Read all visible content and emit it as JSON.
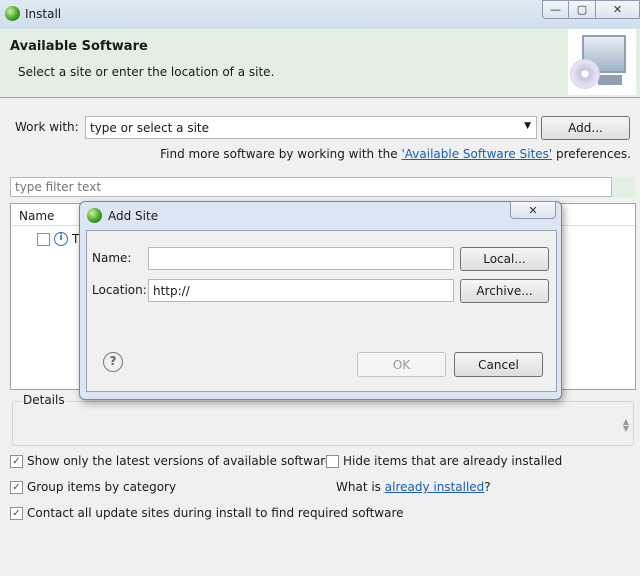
{
  "window": {
    "title": "Install",
    "minimize": "—",
    "maximize": "▢",
    "close": "✕"
  },
  "header": {
    "title": "Available Software",
    "subtitle": "Select a site or enter the location of a site."
  },
  "work_with": {
    "label": "Work with:",
    "value": "type or select a site",
    "add_label": "Add...",
    "find_more_prefix": "Find more software by working with the ",
    "find_more_link": "'Available Software Sites'",
    "find_more_suffix": " preferences."
  },
  "filter": {
    "placeholder": "type filter text"
  },
  "table": {
    "columns": [
      "Name"
    ],
    "rows": [
      {
        "label": "T",
        "checked": false
      }
    ]
  },
  "details": {
    "label": "Details"
  },
  "options": {
    "show_latest": {
      "label": "Show only the latest versions of available software",
      "checked": true
    },
    "hide_installed": {
      "label": "Hide items that are already installed",
      "checked": false
    },
    "group_category": {
      "label": "Group items by category",
      "checked": true
    },
    "what_is_prefix": "What is ",
    "what_is_link": "already installed",
    "what_is_suffix": "?",
    "contact_all": {
      "label": "Contact all update sites during install to find required software",
      "checked": true
    }
  },
  "dialog": {
    "title": "Add Site",
    "close": "✕",
    "name_label": "Name:",
    "name_value": "",
    "location_label": "Location:",
    "location_value": "http://",
    "local_label": "Local...",
    "archive_label": "Archive...",
    "ok_label": "OK",
    "cancel_label": "Cancel",
    "help": "?"
  }
}
